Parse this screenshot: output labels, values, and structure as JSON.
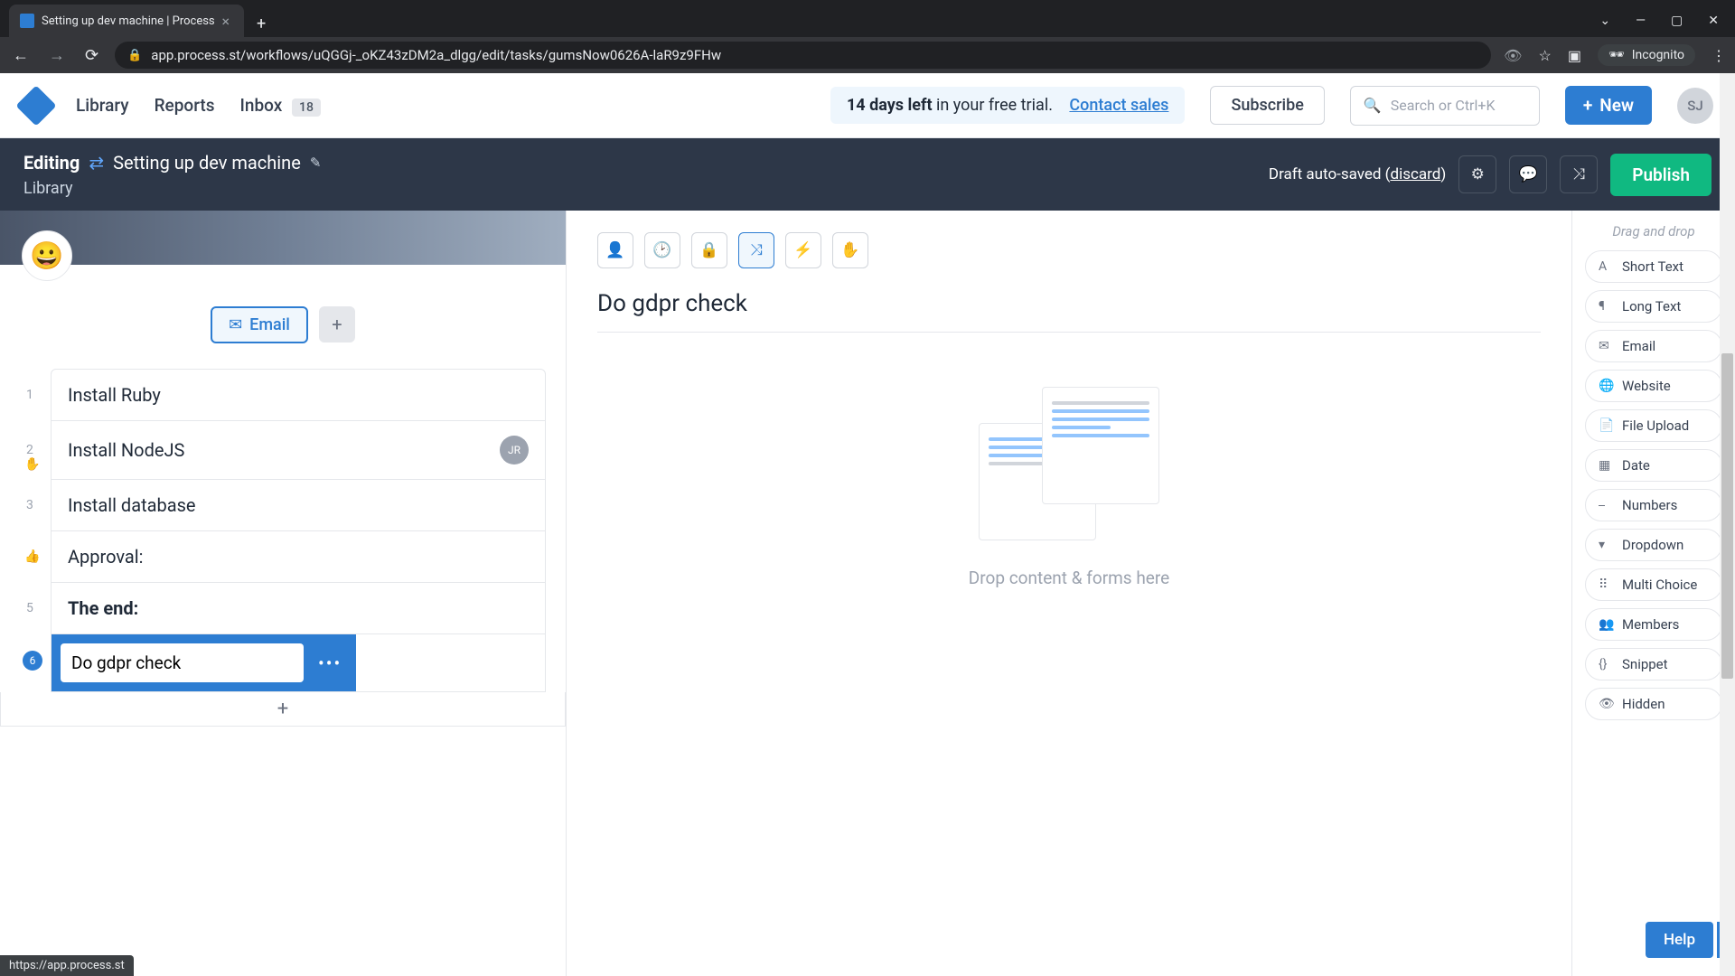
{
  "browser": {
    "tab_title": "Setting up dev machine | Process",
    "url": "app.process.st/workflows/uQGGj-_oKZ43zDM2a_dlgg/edit/tasks/gumsNow0626A-laR9z9FHw",
    "incognito": "Incognito",
    "status_url": "https://app.process.st"
  },
  "topnav": {
    "library": "Library",
    "reports": "Reports",
    "inbox": "Inbox",
    "inbox_count": "18",
    "trial_days": "14 days left",
    "trial_rest": " in your free trial.",
    "contact": "Contact sales",
    "subscribe": "Subscribe",
    "search_placeholder": "Search or Ctrl+K",
    "new": "New",
    "avatar": "SJ"
  },
  "editbar": {
    "editing": "Editing",
    "workflow_name": "Setting up dev machine",
    "breadcrumb": "Library",
    "autosave": "Draft auto-saved (",
    "discard": "discard",
    "autosave_close": ")",
    "publish": "Publish"
  },
  "left": {
    "emoji": "😀",
    "email_btn": "Email",
    "steps": [
      {
        "num": "1",
        "label": "Install Ruby"
      },
      {
        "num": "2",
        "label": "Install NodeJS",
        "assignee": "JR",
        "stop_icon": true
      },
      {
        "num": "3",
        "label": "Install database"
      },
      {
        "num": "",
        "label": "Approval:",
        "thumbs_icon": true
      },
      {
        "num": "5",
        "label": "The end:",
        "bold": true
      }
    ],
    "active_step": {
      "num": "6",
      "value": "Do gdpr check"
    }
  },
  "center": {
    "task_title": "Do gdpr check",
    "dropzone_text": "Drop content & forms here"
  },
  "right": {
    "dnd": "Drag and drop",
    "fields": [
      "Short Text",
      "Long Text",
      "Email",
      "Website",
      "File Upload",
      "Date",
      "Numbers",
      "Dropdown",
      "Multi Choice",
      "Members",
      "Snippet",
      "Hidden"
    ]
  },
  "help": "Help"
}
